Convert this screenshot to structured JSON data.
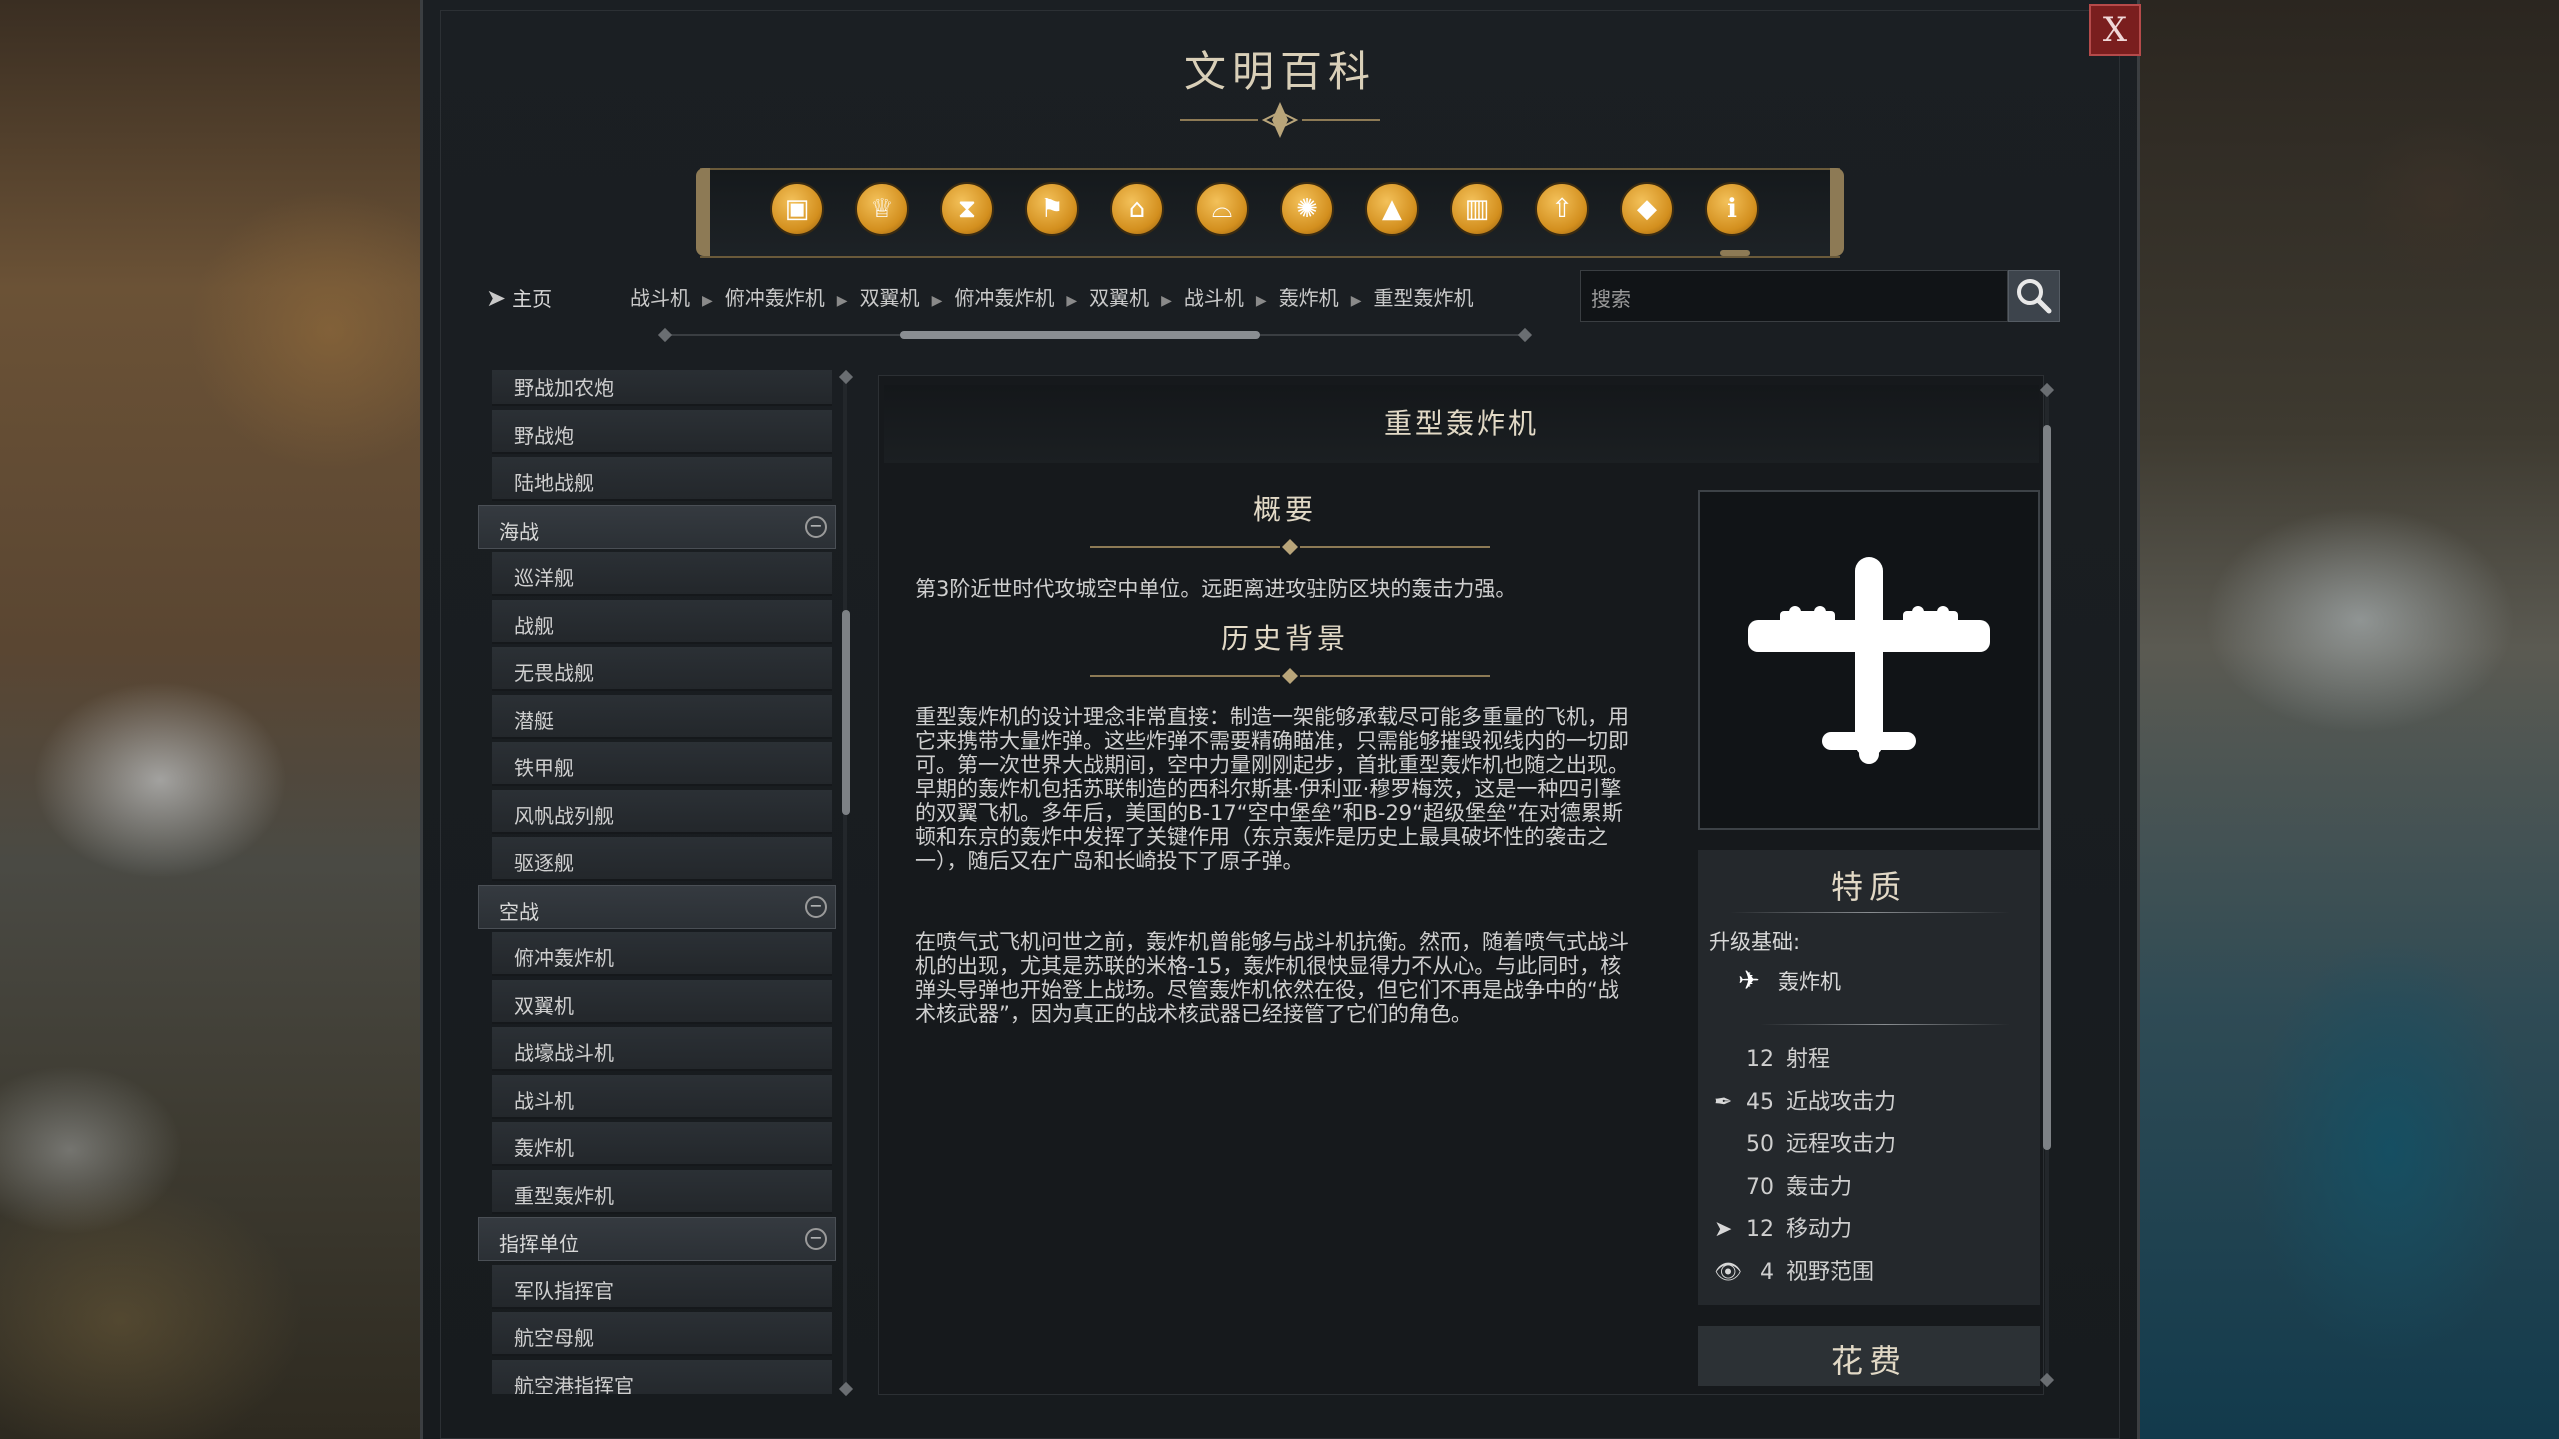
{
  "window": {
    "title": "文明百科",
    "close_label": "X"
  },
  "category_bar": {
    "icons": [
      {
        "name": "units-crate-icon",
        "glyph": "▣"
      },
      {
        "name": "goblet-icon",
        "glyph": "♕"
      },
      {
        "name": "hourglass-icon",
        "glyph": "⧗"
      },
      {
        "name": "flag-icon",
        "glyph": "⚑"
      },
      {
        "name": "government-building-icon",
        "glyph": "⌂"
      },
      {
        "name": "open-book-icon",
        "glyph": "⌓"
      },
      {
        "name": "atom-icon",
        "glyph": "✺"
      },
      {
        "name": "mountain-icon",
        "glyph": "▲"
      },
      {
        "name": "city-building-icon",
        "glyph": "▥"
      },
      {
        "name": "upgrade-arrow-icon",
        "glyph": "⇧"
      },
      {
        "name": "resource-book-icon",
        "glyph": "◆"
      },
      {
        "name": "info-icon",
        "glyph": "ℹ"
      }
    ]
  },
  "navigation": {
    "home_label": "主页",
    "breadcrumbs": [
      "战斗机",
      "俯冲轰炸机",
      "双翼机",
      "俯冲轰炸机",
      "双翼机",
      "战斗机",
      "轰炸机",
      "重型轰炸机"
    ],
    "search_placeholder": "搜索"
  },
  "sidebar": {
    "land_items_tail": [
      "野战加农炮",
      "野战炮",
      "陆地战舰"
    ],
    "naval_header": "海战",
    "naval_items": [
      "巡洋舰",
      "战舰",
      "无畏战舰",
      "潜艇",
      "铁甲舰",
      "风帆战列舰",
      "驱逐舰"
    ],
    "air_header": "空战",
    "air_items": [
      "俯冲轰炸机",
      "双翼机",
      "战壕战斗机",
      "战斗机",
      "轰炸机",
      "重型轰炸机"
    ],
    "command_header": "指挥单位",
    "command_items": [
      "军队指挥官",
      "航空母舰",
      "航空港指挥官"
    ],
    "collapse_symbol": "−"
  },
  "detail": {
    "unit_name": "重型轰炸机",
    "overview_title": "概要",
    "overview_text": "第3阶近世时代攻城空中单位。远距离进攻驻防区块的轰击力强。",
    "history_title": "历史背景",
    "history_p1": "重型轰炸机的设计理念非常直接：制造一架能够承载尽可能多重量的飞机，用它来携带大量炸弹。这些炸弹不需要精确瞄准，只需能够摧毁视线内的一切即可。第一次世界大战期间，空中力量刚刚起步，首批重型轰炸机也随之出现。早期的轰炸机包括苏联制造的西科尔斯基·伊利亚·穆罗梅茨，这是一种四引擎的双翼飞机。多年后，美国的B-17“空中堡垒”和B-29“超级堡垒”在对德累斯顿和东京的轰炸中发挥了关键作用（东京轰炸是历史上最具破坏性的袭击之一），随后又在广岛和长崎投下了原子弹。",
    "history_p2": "在喷气式飞机问世之前，轰炸机曾能够与战斗机抗衡。然而，随着喷气式战斗机的出现，尤其是苏联的米格-15，轰炸机很快显得力不从心。与此同时，核弹头导弹也开始登上战场。尽管轰炸机依然在役，但它们不再是战争中的“战术核武器”，因为真正的战术核武器已经接管了它们的角色。"
  },
  "traits": {
    "title": "特质",
    "upgrade_label": "升级基础:",
    "upgrade_from": "轰炸机",
    "stats": [
      {
        "icon": "",
        "icon_name": "range-blank-icon",
        "value": "12",
        "label": "射程"
      },
      {
        "icon": "✒",
        "icon_name": "melee-attack-icon",
        "value": "45",
        "label": "近战攻击力"
      },
      {
        "icon": "",
        "icon_name": "ranged-attack-blank-icon",
        "value": "50",
        "label": "远程攻击力"
      },
      {
        "icon": "",
        "icon_name": "bombard-blank-icon",
        "value": "70",
        "label": "轰击力"
      },
      {
        "icon": "➤",
        "icon_name": "movement-icon",
        "value": "12",
        "label": "移动力"
      },
      {
        "icon": "👁",
        "icon_name": "vision-eye-icon",
        "value": "4",
        "label": "视野范围"
      }
    ]
  },
  "cost": {
    "title": "花费"
  }
}
